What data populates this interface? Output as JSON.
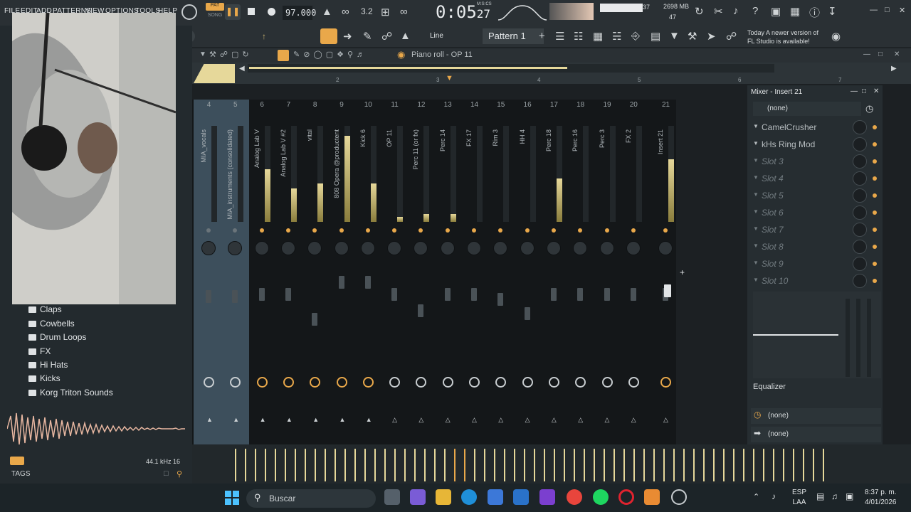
{
  "menu": {
    "items": [
      "FILE",
      "EDIT",
      "ADD",
      "PATTERNS",
      "VIEW",
      "OPTIONS",
      "TOOLS",
      "HELP"
    ]
  },
  "transport": {
    "mode_pat": "PAT",
    "mode_song": "SONG",
    "tempo": "97.000",
    "time": "0:05",
    "time_sub": "27",
    "time_label": "M:S:CS"
  },
  "system": {
    "memory": "2698 MB",
    "cpu": "47",
    "val37": "37"
  },
  "toolbar": {
    "snap": "Line",
    "pattern": "Pattern 1",
    "news_line1": "Today  A newer version of",
    "news_line2": "FL Studio is available!"
  },
  "piano_roll": {
    "title": "Piano roll - OP 11",
    "timeline_marks": [
      "2",
      "3",
      "4",
      "5",
      "6",
      "7"
    ]
  },
  "browser": {
    "items": [
      "Claps",
      "Cowbells",
      "Drum Loops",
      "FX",
      "Hi Hats",
      "Kicks",
      "Korg Triton Sounds"
    ],
    "tags_label": "TAGS",
    "sample_rate": "44.1 kHz",
    "bits": "16"
  },
  "mixer": {
    "title": "Mixer - Insert 21",
    "strips": [
      {
        "num": "4",
        "name": "MIA_vocals"
      },
      {
        "num": "5",
        "name": "MIA_instruments (consolidated)"
      },
      {
        "num": "6",
        "name": "Analog Lab V"
      },
      {
        "num": "7",
        "name": "Analog Lab V #2"
      },
      {
        "num": "8",
        "name": "vital"
      },
      {
        "num": "9",
        "name": "808 Opera @productent"
      },
      {
        "num": "10",
        "name": "Kick 6"
      },
      {
        "num": "11",
        "name": "OP 11"
      },
      {
        "num": "12",
        "name": "Perc 11 (or fx)"
      },
      {
        "num": "13",
        "name": "Perc 14"
      },
      {
        "num": "14",
        "name": "FX 17"
      },
      {
        "num": "15",
        "name": "Rim 3"
      },
      {
        "num": "16",
        "name": "HH 4"
      },
      {
        "num": "17",
        "name": "Perc 18"
      },
      {
        "num": "18",
        "name": "Perc 16"
      },
      {
        "num": "19",
        "name": "Perc 3"
      },
      {
        "num": "20",
        "name": "FX 2"
      },
      {
        "num": "21",
        "name": "Insert 21"
      }
    ],
    "insert": {
      "preset": "(none)",
      "slots": [
        {
          "name": "CamelCrusher",
          "active": true
        },
        {
          "name": "kHs Ring Mod",
          "active": true
        },
        {
          "name": "Slot 3",
          "active": false
        },
        {
          "name": "Slot 4",
          "active": false
        },
        {
          "name": "Slot 5",
          "active": false
        },
        {
          "name": "Slot 6",
          "active": false
        },
        {
          "name": "Slot 7",
          "active": false
        },
        {
          "name": "Slot 8",
          "active": false
        },
        {
          "name": "Slot 9",
          "active": false
        },
        {
          "name": "Slot 10",
          "active": false
        }
      ],
      "equalizer_label": "Equalizer",
      "in_route": "(none)",
      "out_route": "(none)"
    }
  },
  "taskbar": {
    "search_placeholder": "Buscar",
    "lang1": "ESP",
    "lang2": "LAA",
    "time": "8:37 p. m.",
    "date": "4/01/2026"
  }
}
